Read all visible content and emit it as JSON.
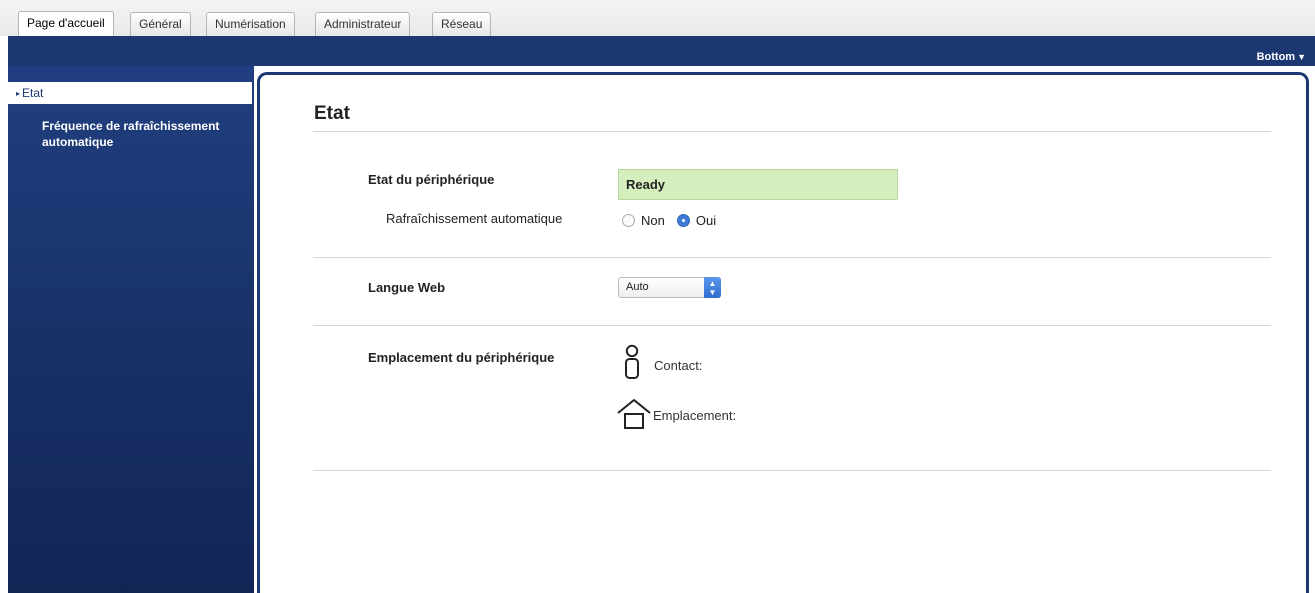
{
  "tabs": [
    {
      "label": "Page d'accueil",
      "active": true
    },
    {
      "label": "Général",
      "active": false
    },
    {
      "label": "Numérisation",
      "active": false
    },
    {
      "label": "Administrateur",
      "active": false
    },
    {
      "label": "Réseau",
      "active": false
    }
  ],
  "header": {
    "bottom_link": "Bottom",
    "bottom_arrow": "▼"
  },
  "sidebar": {
    "items": [
      {
        "label": "Etat",
        "active": true
      },
      {
        "label": "Fréquence de rafraîchissement automatique",
        "active": false
      }
    ]
  },
  "main": {
    "title": "Etat",
    "device_status_label": "Etat du périphérique",
    "device_status_value": "Ready",
    "auto_refresh_label": "Rafraîchissement automatique",
    "auto_refresh_options": [
      {
        "label": "Non",
        "checked": false
      },
      {
        "label": "Oui",
        "checked": true
      }
    ],
    "web_language_label": "Langue Web",
    "web_language_value": "Auto",
    "location_label": "Emplacement du périphérique",
    "contact_label": "Contact:",
    "location_field_label": "Emplacement:"
  },
  "colors": {
    "brand_navy": "#1c3772",
    "status_ok_bg": "#d5eebd",
    "radio_selected": "#3e7ad6"
  },
  "icons": [
    "person-icon",
    "house-icon",
    "select-arrows-icon",
    "triangle-down-icon",
    "triangle-right-icon"
  ]
}
